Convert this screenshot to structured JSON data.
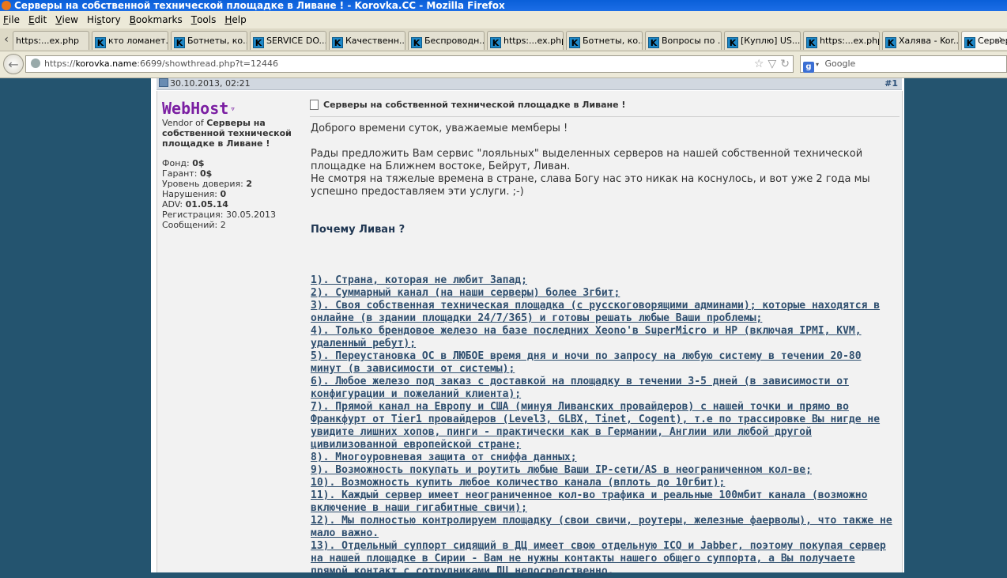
{
  "window": {
    "title": "Серверы на собственной технической площадке в Ливане ! - Korovka.CC - Mozilla Firefox"
  },
  "menu": [
    {
      "pre": "",
      "key": "F",
      "post": "ile"
    },
    {
      "pre": "",
      "key": "E",
      "post": "dit"
    },
    {
      "pre": "",
      "key": "V",
      "post": "iew"
    },
    {
      "pre": "Hi",
      "key": "s",
      "post": "tory"
    },
    {
      "pre": "",
      "key": "B",
      "post": "ookmarks"
    },
    {
      "pre": "",
      "key": "T",
      "post": "ools"
    },
    {
      "pre": "",
      "key": "H",
      "post": "elp"
    }
  ],
  "tabs": [
    {
      "label": "https:...ex.php",
      "has_icon": false
    },
    {
      "label": "кто ломанет...",
      "has_icon": true
    },
    {
      "label": "Ботнеты, ко...",
      "has_icon": true
    },
    {
      "label": "SERVICE DO...",
      "has_icon": true
    },
    {
      "label": "Качественн...",
      "has_icon": true
    },
    {
      "label": "Беспроводн...",
      "has_icon": true
    },
    {
      "label": "https:...ex.php",
      "has_icon": true
    },
    {
      "label": "Ботнеты, ко...",
      "has_icon": true
    },
    {
      "label": "Вопросы по ...",
      "has_icon": true
    },
    {
      "label": "[Куплю] US...",
      "has_icon": true
    },
    {
      "label": "https:...ex.php",
      "has_icon": true
    },
    {
      "label": "Халява - Kor...",
      "has_icon": true
    },
    {
      "label": "Серверы ...",
      "has_icon": true,
      "active": true
    }
  ],
  "address": {
    "prefix": "https://",
    "host": "korovka.name",
    "rest": ":6699/showthread.php?t=12446"
  },
  "search": {
    "placeholder": "Google"
  },
  "post": {
    "date": "30.10.2013, 02:21",
    "number": "#1",
    "user": {
      "name": "WebHost",
      "vendor_prefix": "Vendor of ",
      "vendor_of": "Серверы на собственной технической площадке в Ливане !",
      "stats": [
        {
          "label": "Фонд: ",
          "value": "0$"
        },
        {
          "label": "Гарант: ",
          "value": "0$"
        },
        {
          "label": "Уровень доверия: ",
          "value": "2"
        },
        {
          "label": "Нарушения: ",
          "value": "0"
        },
        {
          "label": "ADV: ",
          "value": "01.05.14"
        },
        {
          "label": "Регистрация: ",
          "value": "30.05.2013"
        },
        {
          "label": "Сообщений: ",
          "value": "2"
        }
      ]
    },
    "title": "Серверы на собственной технической площадке в Ливане !",
    "greeting": "Доброго времени суток, уважаемые мемберы !",
    "intro1": "Рады предложить Вам сервис \"лояльных\" выделенных серверов на нашей собственной технической площадке на Ближнем востоке, Бейрут, Ливан.",
    "intro2": "Не смотря на тяжелые времена в стране, слава Богу нас это никак на коснулось, и вот уже 2 года мы успешно предоставляем эти услуги. ;-)",
    "why": "Почему Ливан ?",
    "points": [
      "1). Страна, которая не любит Запад;",
      "2). Суммарный канал (на наши серверы) более 3гбит;",
      "3). Своя собственная техническая площадка (с русскоговорящими админами); которые находятся в онлайне (в здании площадки 24/7/365) и готовы решать любые Ваши проблемы;",
      "4). Только брендовое железо на базе последних Xeono'в SuperMicro и HP (включая IPMI, KVM, удаленный ребут);",
      "5). Переустановка ОС в ЛЮБОЕ время дня и ночи по запросу на любую систему в течении 20-80 минут (в зависимости от системы);",
      "6). Любое железо под заказ с доставкой на площадку в течении 3-5 дней (в зависимости от конфигурации и пожеланий клиента);",
      "7). Прямой канал на Европу и США (минуя Ливанских провайдеров) с нашей точки и прямо во Франкфурт от Tier1 провайдеров (Level3, GLBX, Tinet, Cogent), т.е по трассировке Вы нигде не увидите лишних хопов, пинги - практически как в Германии, Англии или любой другой цивилизованной европейской стране;",
      "8). Многоуровневая защита от сниффа данных;",
      "9). Возможность покупать и роутить любые Ваши IP-сети/AS в неограниченном кол-ве;",
      "10). Возможность купить любое количество канала (вплоть до 10гбит);",
      "11). Каждый сервер имеет неограниченное кол-во трафика и реальные 100мбит канала (возможно включение в наши гигабитные свичи);",
      "12). Мы полностью контролируем площадку (свои свичи, роутеры, железные фаерволы), что также не мало важно.",
      "13). Отдельный суппорт сидящий в ДЦ имеет свою отдельную ICQ и Jabber, поэтому покупая сервер на нашей площадке в Сирии - Вам не нужны контакты нашего общего суппорта, а Вы получаете прямой контакт с сотрудниками ДЦ непосредственно."
    ]
  }
}
